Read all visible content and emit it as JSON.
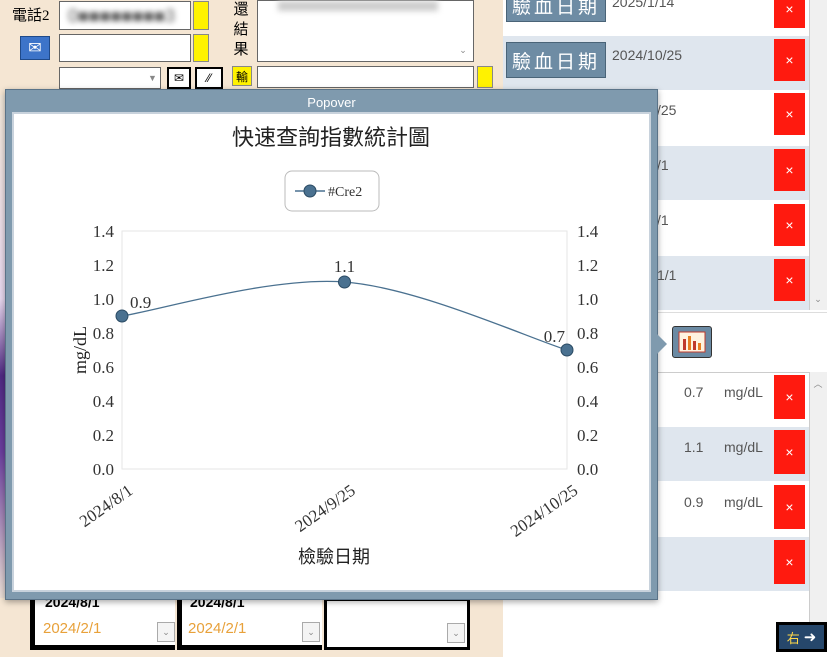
{
  "left_panel": {
    "phone_label": "電話2",
    "phone_value": "0■■■■■■■■3",
    "result_label": "結果",
    "result_char1": "還",
    "transfuse_label": "輸",
    "bottom_dates_bold": [
      "2024/8/1",
      "2024/8/1"
    ],
    "bottom_dates_muted": [
      "2024/2/1",
      "2024/2/1"
    ]
  },
  "right_panel": {
    "date_label": "驗血日期",
    "top_rows": [
      {
        "label": "驗血日期",
        "date": "2025/1/14"
      },
      {
        "label": "驗血日期",
        "date": "2024/10/25"
      }
    ],
    "partial_dates": [
      "/25",
      "/1",
      "/1",
      "1/1"
    ],
    "delete_symbol": "×",
    "values": [
      {
        "value": "0.7",
        "unit": "mg/dL"
      },
      {
        "value": "1.1",
        "unit": "mg/dL"
      },
      {
        "value": "0.9",
        "unit": "mg/dL"
      },
      {
        "value": "",
        "unit": ""
      }
    ],
    "nav_right_label": "右"
  },
  "popover": {
    "title": "Popover"
  },
  "chart_data": {
    "type": "line",
    "title": "快速查詢指數統計圖",
    "categories": [
      "2024/8/1",
      "2024/9/25",
      "2024/10/25"
    ],
    "series": [
      {
        "name": "#Cre2",
        "values": [
          0.9,
          1.1,
          0.7
        ],
        "color": "#4a7190"
      }
    ],
    "xlabel": "檢驗日期",
    "ylabel": "mg/dL",
    "ylim": [
      0,
      1.4
    ],
    "yticks": [
      "0.0",
      "0.2",
      "0.4",
      "0.6",
      "0.8",
      "1.0",
      "1.2",
      "1.4"
    ],
    "data_labels": [
      "0.9",
      "1.1",
      "0.7"
    ],
    "legend_position": "top-center",
    "grid": false,
    "secondary_y_axis": true
  }
}
